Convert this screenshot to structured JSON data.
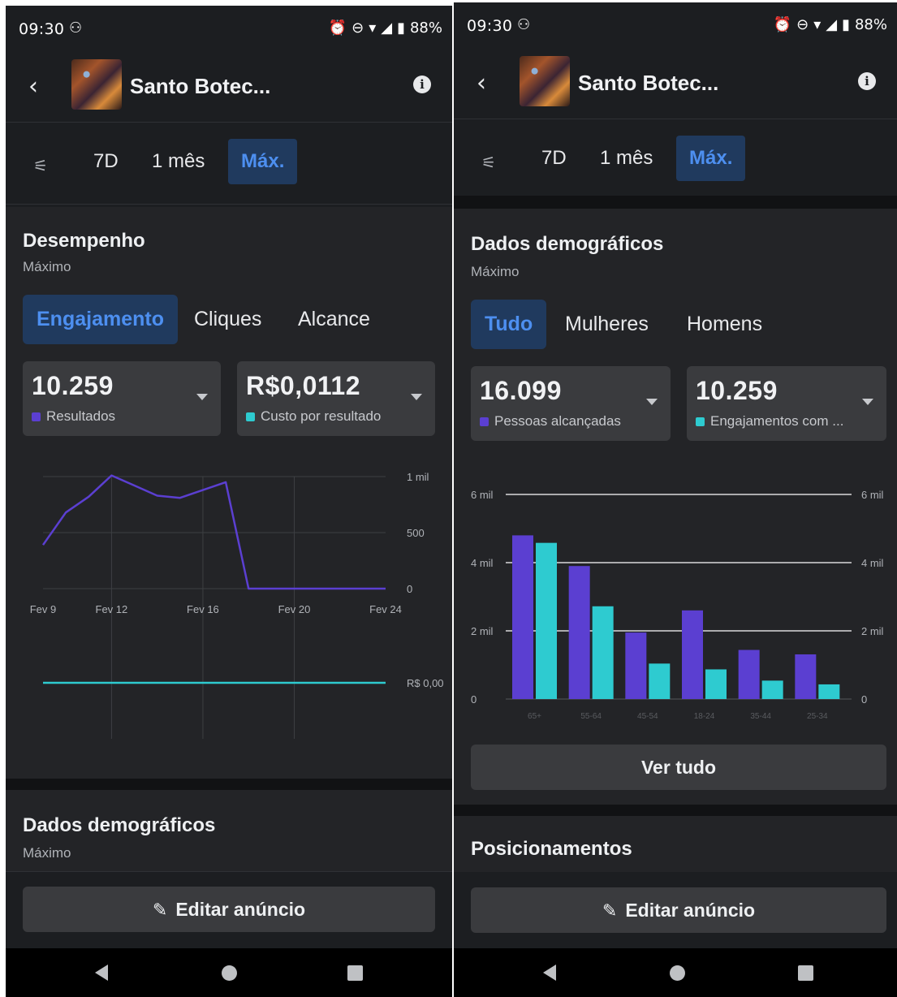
{
  "status": {
    "time": "09:30",
    "battery": "88%",
    "icons": [
      "alarm-icon",
      "dnd-icon",
      "wifi-icon",
      "signal-icon",
      "battery-icon"
    ]
  },
  "app": {
    "title": "Santo Botec...",
    "back_glyph": "‹",
    "info_glyph": "i"
  },
  "range": {
    "options": [
      "7D",
      "1 mês",
      "Máx."
    ],
    "active": "Máx."
  },
  "left": {
    "performance": {
      "title": "Desempenho",
      "subtitle": "Máximo",
      "tabs": [
        "Engajamento",
        "Cliques",
        "Alcance"
      ],
      "active_tab": "Engajamento",
      "metrics": [
        {
          "value": "10.259",
          "label": "Resultados",
          "color": "#5b3fd1"
        },
        {
          "value": "R$0,0112",
          "label": "Custo por resultado",
          "color": "#2ecbd0"
        }
      ],
      "chart_data": {
        "type": "line",
        "x": [
          "Fev 9",
          "Fev 10",
          "Fev 11",
          "Fev 12",
          "Fev 13",
          "Fev 14",
          "Fev 15",
          "Fev 16",
          "Fev 17",
          "Fev 18",
          "Fev 19",
          "Fev 20",
          "Fev 21",
          "Fev 22",
          "Fev 23",
          "Fev 24"
        ],
        "x_ticks": [
          "Fev 9",
          "Fev 12",
          "Fev 16",
          "Fev 20",
          "Fev 24"
        ],
        "y_ticks": [
          "1 mil",
          "500",
          "0"
        ],
        "ylim": [
          0,
          1000
        ],
        "series": [
          {
            "values": [
              390,
              680,
              820,
              1010,
              920,
              830,
              810,
              880,
              950,
              0,
              0,
              0,
              0,
              0,
              0,
              0
            ],
            "color": "#5b3fd1"
          }
        ]
      },
      "chart_cost": {
        "type": "line",
        "y_ticks": [
          "R$ 0,00"
        ],
        "series": [
          {
            "values": [
              0,
              0,
              0,
              0,
              0
            ],
            "color": "#2ecbd0"
          }
        ]
      }
    },
    "demographics": {
      "title": "Dados demográficos",
      "subtitle": "Máximo"
    },
    "edit_button": "Editar anúncio"
  },
  "right": {
    "demographics": {
      "title": "Dados demográficos",
      "subtitle": "Máximo",
      "tabs": [
        "Tudo",
        "Mulheres",
        "Homens"
      ],
      "active_tab": "Tudo",
      "metrics": [
        {
          "value": "16.099",
          "label": "Pessoas alcançadas",
          "color": "#5b3fd1"
        },
        {
          "value": "10.259",
          "label": "Engajamentos com ...",
          "color": "#2ecbd0"
        }
      ],
      "chart_data": {
        "type": "bar",
        "categories": [
          "65+",
          "55-64",
          "45-54",
          "18-24",
          "35-44",
          "25-34"
        ],
        "y_ticks": [
          "6 mil",
          "4 mil",
          "2 mil",
          "0"
        ],
        "ylim": [
          0,
          6000
        ],
        "series": [
          {
            "values": [
              4800,
              3900,
              1950,
              2600,
              1440,
              1310
            ],
            "color": "#5b3fd1"
          },
          {
            "values": [
              4580,
              2720,
              1040,
              870,
              540,
              430
            ],
            "color": "#2ecbd0"
          }
        ]
      },
      "see_all": "Ver tudo"
    },
    "placements": {
      "title": "Posicionamentos"
    },
    "edit_button": "Editar anúncio"
  }
}
